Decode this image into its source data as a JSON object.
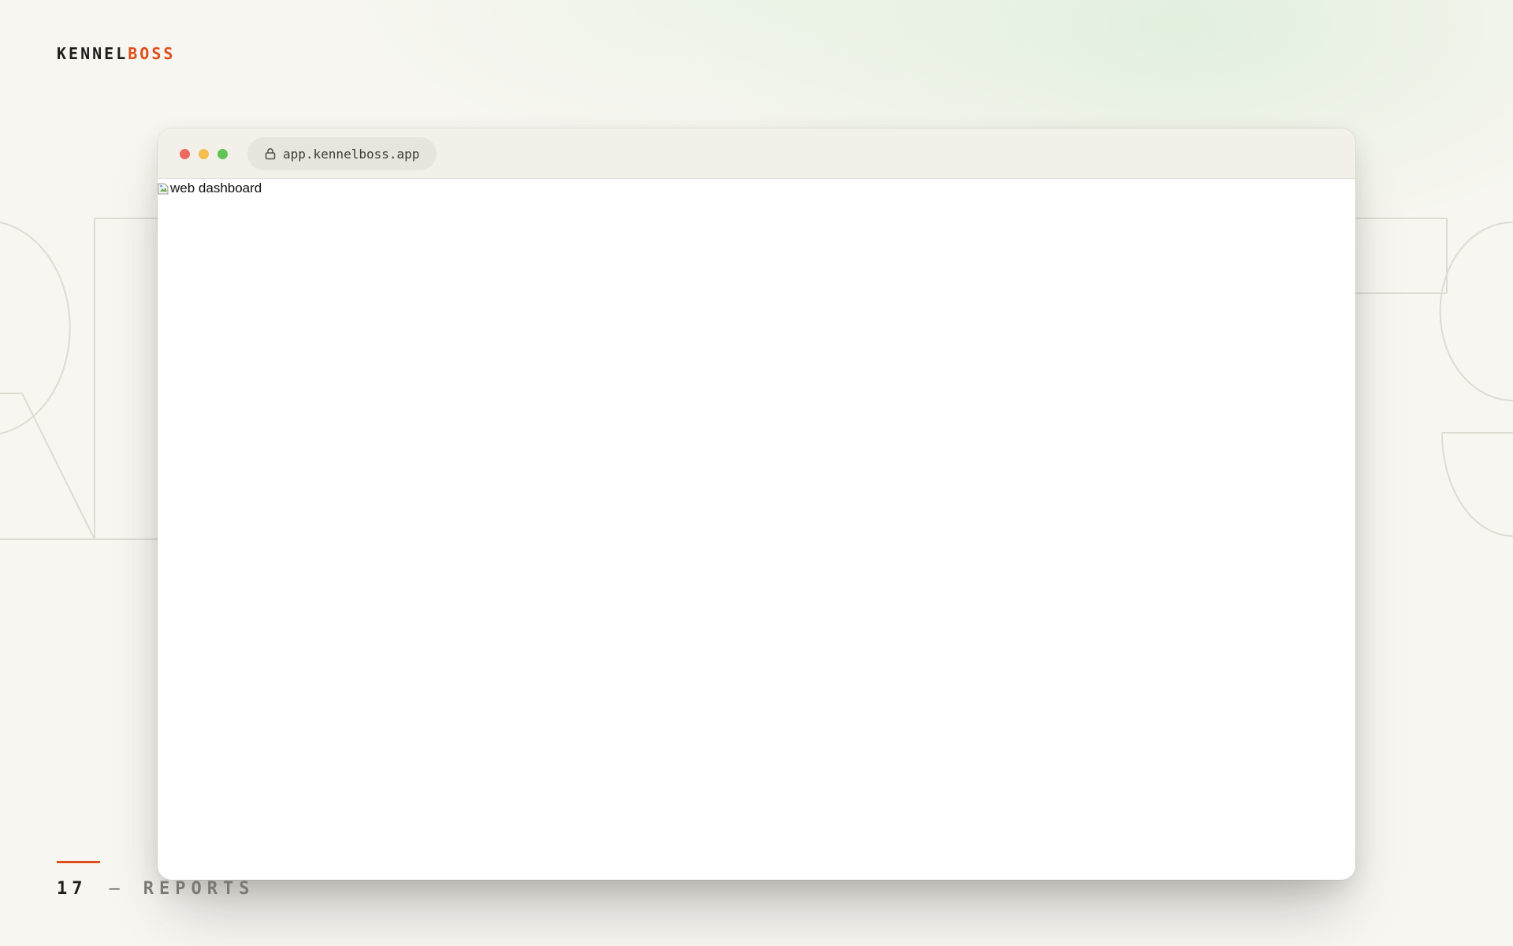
{
  "brand": {
    "name_part1": "KENNEL",
    "name_part2": "BOSS",
    "accent_color": "#e04e1c"
  },
  "background": {
    "outline_letters_icon": "decorative-outline-letters"
  },
  "browser": {
    "window_controls": [
      "close",
      "minimize",
      "maximize"
    ],
    "url": "app.kennelboss.app",
    "url_icon": "lock-icon",
    "content": {
      "image_alt": "web dashboard",
      "image_icon": "broken-image-icon"
    }
  },
  "footer": {
    "page_number": "17",
    "separator": "—",
    "section": "REPORTS"
  }
}
